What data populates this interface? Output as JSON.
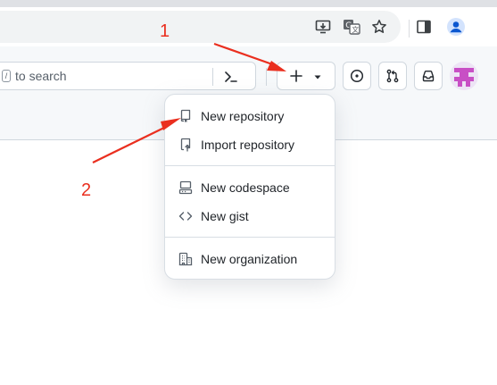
{
  "browser": {
    "icons": [
      "install-app-icon",
      "translate-icon",
      "bookmark-star-icon",
      "side-panel-icon",
      "profile-icon"
    ]
  },
  "header": {
    "search": {
      "kbd": "/",
      "placeholder": "to search"
    },
    "create_button_icons": [
      "plus-icon",
      "triangle-down-icon"
    ],
    "buttons": [
      "issues-icon",
      "pull-requests-icon",
      "inbox-icon"
    ]
  },
  "dropdown": {
    "groups": [
      [
        {
          "label": "New repository",
          "icon": "repo-icon"
        },
        {
          "label": "Import repository",
          "icon": "repo-push-icon"
        }
      ],
      [
        {
          "label": "New codespace",
          "icon": "codespaces-icon"
        },
        {
          "label": "New gist",
          "icon": "code-icon"
        }
      ],
      [
        {
          "label": "New organization",
          "icon": "organization-icon"
        }
      ]
    ]
  },
  "annotations": {
    "labels": [
      "1",
      "2"
    ],
    "color": "#ea2f1f"
  },
  "colors": {
    "accent_avatar": "#c84fc5",
    "header_bg": "#f6f8fa",
    "border": "#d0d7de"
  }
}
